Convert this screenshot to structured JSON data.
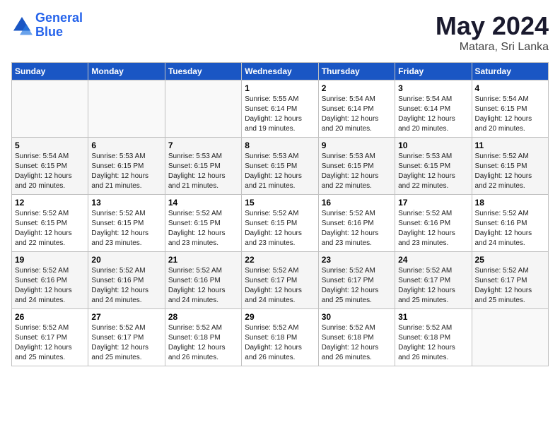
{
  "header": {
    "logo_line1": "General",
    "logo_line2": "Blue",
    "month": "May 2024",
    "location": "Matara, Sri Lanka"
  },
  "weekdays": [
    "Sunday",
    "Monday",
    "Tuesday",
    "Wednesday",
    "Thursday",
    "Friday",
    "Saturday"
  ],
  "weeks": [
    [
      {
        "day": "",
        "info": ""
      },
      {
        "day": "",
        "info": ""
      },
      {
        "day": "",
        "info": ""
      },
      {
        "day": "1",
        "info": "Sunrise: 5:55 AM\nSunset: 6:14 PM\nDaylight: 12 hours\nand 19 minutes."
      },
      {
        "day": "2",
        "info": "Sunrise: 5:54 AM\nSunset: 6:14 PM\nDaylight: 12 hours\nand 20 minutes."
      },
      {
        "day": "3",
        "info": "Sunrise: 5:54 AM\nSunset: 6:14 PM\nDaylight: 12 hours\nand 20 minutes."
      },
      {
        "day": "4",
        "info": "Sunrise: 5:54 AM\nSunset: 6:15 PM\nDaylight: 12 hours\nand 20 minutes."
      }
    ],
    [
      {
        "day": "5",
        "info": "Sunrise: 5:54 AM\nSunset: 6:15 PM\nDaylight: 12 hours\nand 20 minutes."
      },
      {
        "day": "6",
        "info": "Sunrise: 5:53 AM\nSunset: 6:15 PM\nDaylight: 12 hours\nand 21 minutes."
      },
      {
        "day": "7",
        "info": "Sunrise: 5:53 AM\nSunset: 6:15 PM\nDaylight: 12 hours\nand 21 minutes."
      },
      {
        "day": "8",
        "info": "Sunrise: 5:53 AM\nSunset: 6:15 PM\nDaylight: 12 hours\nand 21 minutes."
      },
      {
        "day": "9",
        "info": "Sunrise: 5:53 AM\nSunset: 6:15 PM\nDaylight: 12 hours\nand 22 minutes."
      },
      {
        "day": "10",
        "info": "Sunrise: 5:53 AM\nSunset: 6:15 PM\nDaylight: 12 hours\nand 22 minutes."
      },
      {
        "day": "11",
        "info": "Sunrise: 5:52 AM\nSunset: 6:15 PM\nDaylight: 12 hours\nand 22 minutes."
      }
    ],
    [
      {
        "day": "12",
        "info": "Sunrise: 5:52 AM\nSunset: 6:15 PM\nDaylight: 12 hours\nand 22 minutes."
      },
      {
        "day": "13",
        "info": "Sunrise: 5:52 AM\nSunset: 6:15 PM\nDaylight: 12 hours\nand 23 minutes."
      },
      {
        "day": "14",
        "info": "Sunrise: 5:52 AM\nSunset: 6:15 PM\nDaylight: 12 hours\nand 23 minutes."
      },
      {
        "day": "15",
        "info": "Sunrise: 5:52 AM\nSunset: 6:15 PM\nDaylight: 12 hours\nand 23 minutes."
      },
      {
        "day": "16",
        "info": "Sunrise: 5:52 AM\nSunset: 6:16 PM\nDaylight: 12 hours\nand 23 minutes."
      },
      {
        "day": "17",
        "info": "Sunrise: 5:52 AM\nSunset: 6:16 PM\nDaylight: 12 hours\nand 23 minutes."
      },
      {
        "day": "18",
        "info": "Sunrise: 5:52 AM\nSunset: 6:16 PM\nDaylight: 12 hours\nand 24 minutes."
      }
    ],
    [
      {
        "day": "19",
        "info": "Sunrise: 5:52 AM\nSunset: 6:16 PM\nDaylight: 12 hours\nand 24 minutes."
      },
      {
        "day": "20",
        "info": "Sunrise: 5:52 AM\nSunset: 6:16 PM\nDaylight: 12 hours\nand 24 minutes."
      },
      {
        "day": "21",
        "info": "Sunrise: 5:52 AM\nSunset: 6:16 PM\nDaylight: 12 hours\nand 24 minutes."
      },
      {
        "day": "22",
        "info": "Sunrise: 5:52 AM\nSunset: 6:17 PM\nDaylight: 12 hours\nand 24 minutes."
      },
      {
        "day": "23",
        "info": "Sunrise: 5:52 AM\nSunset: 6:17 PM\nDaylight: 12 hours\nand 25 minutes."
      },
      {
        "day": "24",
        "info": "Sunrise: 5:52 AM\nSunset: 6:17 PM\nDaylight: 12 hours\nand 25 minutes."
      },
      {
        "day": "25",
        "info": "Sunrise: 5:52 AM\nSunset: 6:17 PM\nDaylight: 12 hours\nand 25 minutes."
      }
    ],
    [
      {
        "day": "26",
        "info": "Sunrise: 5:52 AM\nSunset: 6:17 PM\nDaylight: 12 hours\nand 25 minutes."
      },
      {
        "day": "27",
        "info": "Sunrise: 5:52 AM\nSunset: 6:17 PM\nDaylight: 12 hours\nand 25 minutes."
      },
      {
        "day": "28",
        "info": "Sunrise: 5:52 AM\nSunset: 6:18 PM\nDaylight: 12 hours\nand 26 minutes."
      },
      {
        "day": "29",
        "info": "Sunrise: 5:52 AM\nSunset: 6:18 PM\nDaylight: 12 hours\nand 26 minutes."
      },
      {
        "day": "30",
        "info": "Sunrise: 5:52 AM\nSunset: 6:18 PM\nDaylight: 12 hours\nand 26 minutes."
      },
      {
        "day": "31",
        "info": "Sunrise: 5:52 AM\nSunset: 6:18 PM\nDaylight: 12 hours\nand 26 minutes."
      },
      {
        "day": "",
        "info": ""
      }
    ]
  ]
}
